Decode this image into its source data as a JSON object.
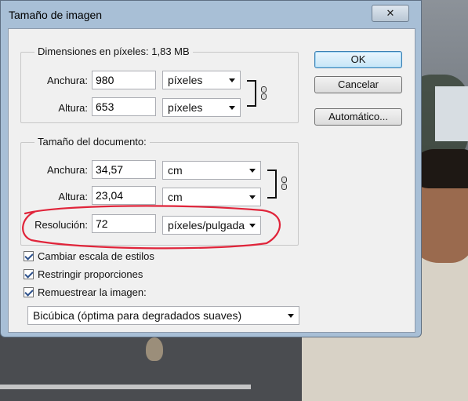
{
  "window": {
    "title": "Tamaño de imagen",
    "close_glyph": "✕"
  },
  "pixel_dimensions": {
    "legend_prefix": "Dimensiones en píxeles:",
    "size": "1,83 MB",
    "width_label": "Anchura:",
    "width_value": "980",
    "width_unit": "píxeles",
    "height_label": "Altura:",
    "height_value": "653",
    "height_unit": "píxeles"
  },
  "document_size": {
    "legend": "Tamaño del documento:",
    "width_label": "Anchura:",
    "width_value": "34,57",
    "width_unit": "cm",
    "height_label": "Altura:",
    "height_value": "23,04",
    "height_unit": "cm",
    "resolution_label": "Resolución:",
    "resolution_value": "72",
    "resolution_unit": "píxeles/pulgada"
  },
  "buttons": {
    "ok": "OK",
    "cancel": "Cancelar",
    "auto": "Automático..."
  },
  "options": [
    {
      "label": "Cambiar escala de estilos",
      "checked": true
    },
    {
      "label": "Restringir proporciones",
      "checked": true
    },
    {
      "label": "Remuestrear la imagen:",
      "checked": true
    }
  ],
  "resample_method": "Bicúbica (óptima para degradados suaves)",
  "colors": {
    "annotation_red": "#e0243a",
    "titlebar": "#a8bfd6",
    "client_bg": "#f0f0f0"
  }
}
